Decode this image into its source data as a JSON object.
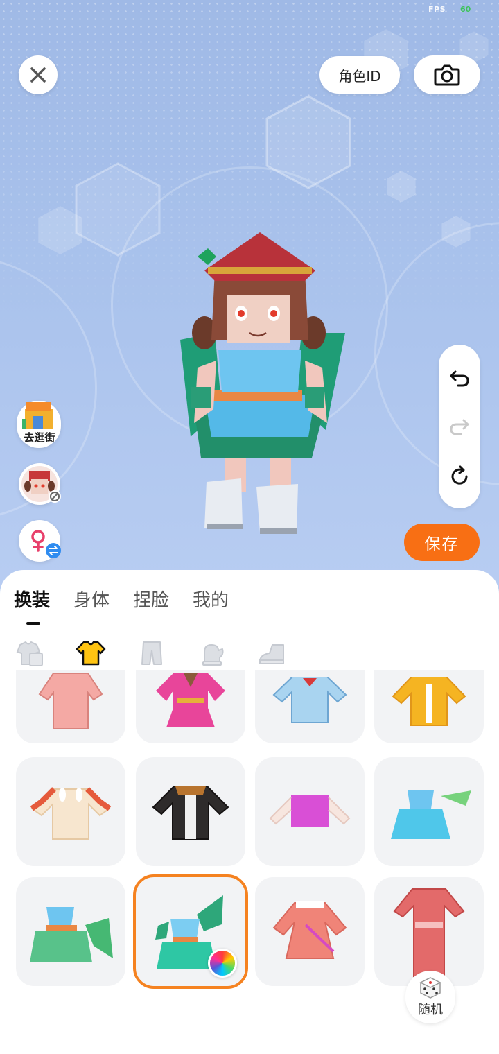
{
  "status": {
    "fps_label": "FPS",
    "fps_value": "60"
  },
  "header": {
    "role_id_label": "角色ID"
  },
  "side": {
    "shop_label": "去逛街"
  },
  "actions": {
    "save_label": "保存",
    "random_label": "随机"
  },
  "tabs": [
    {
      "label": "换装",
      "active": true
    },
    {
      "label": "身体",
      "active": false
    },
    {
      "label": "捏脸",
      "active": false
    },
    {
      "label": "我的",
      "active": false
    }
  ],
  "categories": [
    {
      "icon": "outfit-set-icon",
      "active": false
    },
    {
      "icon": "top-shirt-icon",
      "active": true
    },
    {
      "icon": "pants-icon",
      "active": false
    },
    {
      "icon": "glove-icon",
      "active": false
    },
    {
      "icon": "shoe-icon",
      "active": false
    }
  ],
  "items": [
    {
      "name": "pink-coat",
      "selected": false
    },
    {
      "name": "pink-dress",
      "selected": false
    },
    {
      "name": "blue-sailor-top",
      "selected": false
    },
    {
      "name": "yellow-jacket",
      "selected": false
    },
    {
      "name": "cream-bunny-top",
      "selected": false
    },
    {
      "name": "black-jacket",
      "selected": false
    },
    {
      "name": "purple-crop-top",
      "selected": false
    },
    {
      "name": "blue-leaf-dress",
      "selected": false
    },
    {
      "name": "green-leaf-dress",
      "selected": false
    },
    {
      "name": "fairy-dress",
      "selected": true
    },
    {
      "name": "salmon-dress",
      "selected": false
    },
    {
      "name": "red-qipao",
      "selected": false
    }
  ],
  "colors": {
    "accent": "#f86f14",
    "selected_border": "#f58220",
    "fps_green": "#3ec35b"
  }
}
